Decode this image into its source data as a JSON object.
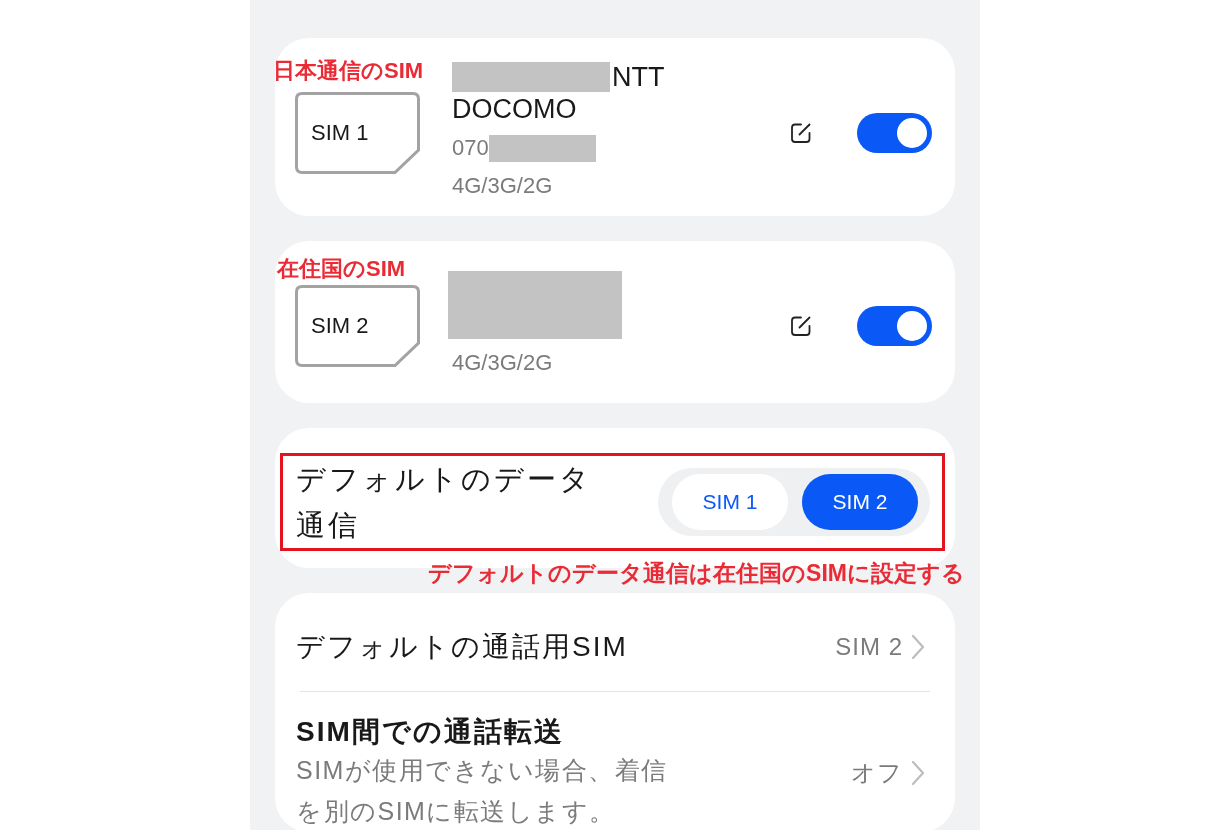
{
  "sim_cards": [
    {
      "annotation": "日本通信のSIM",
      "slot": "SIM 1",
      "name_redacted": true,
      "name_lines": [
        "NTT",
        "DOCOMO"
      ],
      "number": "070",
      "number_redacted": true,
      "network": "4G/3G/2G",
      "on": true
    },
    {
      "annotation": "在住国のSIM",
      "slot": "SIM 2",
      "details_redacted": true,
      "network": "4G/3G/2G",
      "on": true
    }
  ],
  "default_data": {
    "title": "デフォルトのデータ通信",
    "highlighted": true,
    "options": [
      {
        "label": "SIM 1",
        "selected": false
      },
      {
        "label": "SIM 2",
        "selected": true
      }
    ],
    "annotation": "デフォルトのデータ通信は在住国のSIMに設定する"
  },
  "call_settings": [
    {
      "title": "デフォルトの通話用SIM",
      "value": "SIM 2"
    },
    {
      "title": "SIM間での通話転送",
      "subtitle": "SIMが使用できない場合、着信を別のSIMに転送します。",
      "value": "オフ"
    }
  ]
}
